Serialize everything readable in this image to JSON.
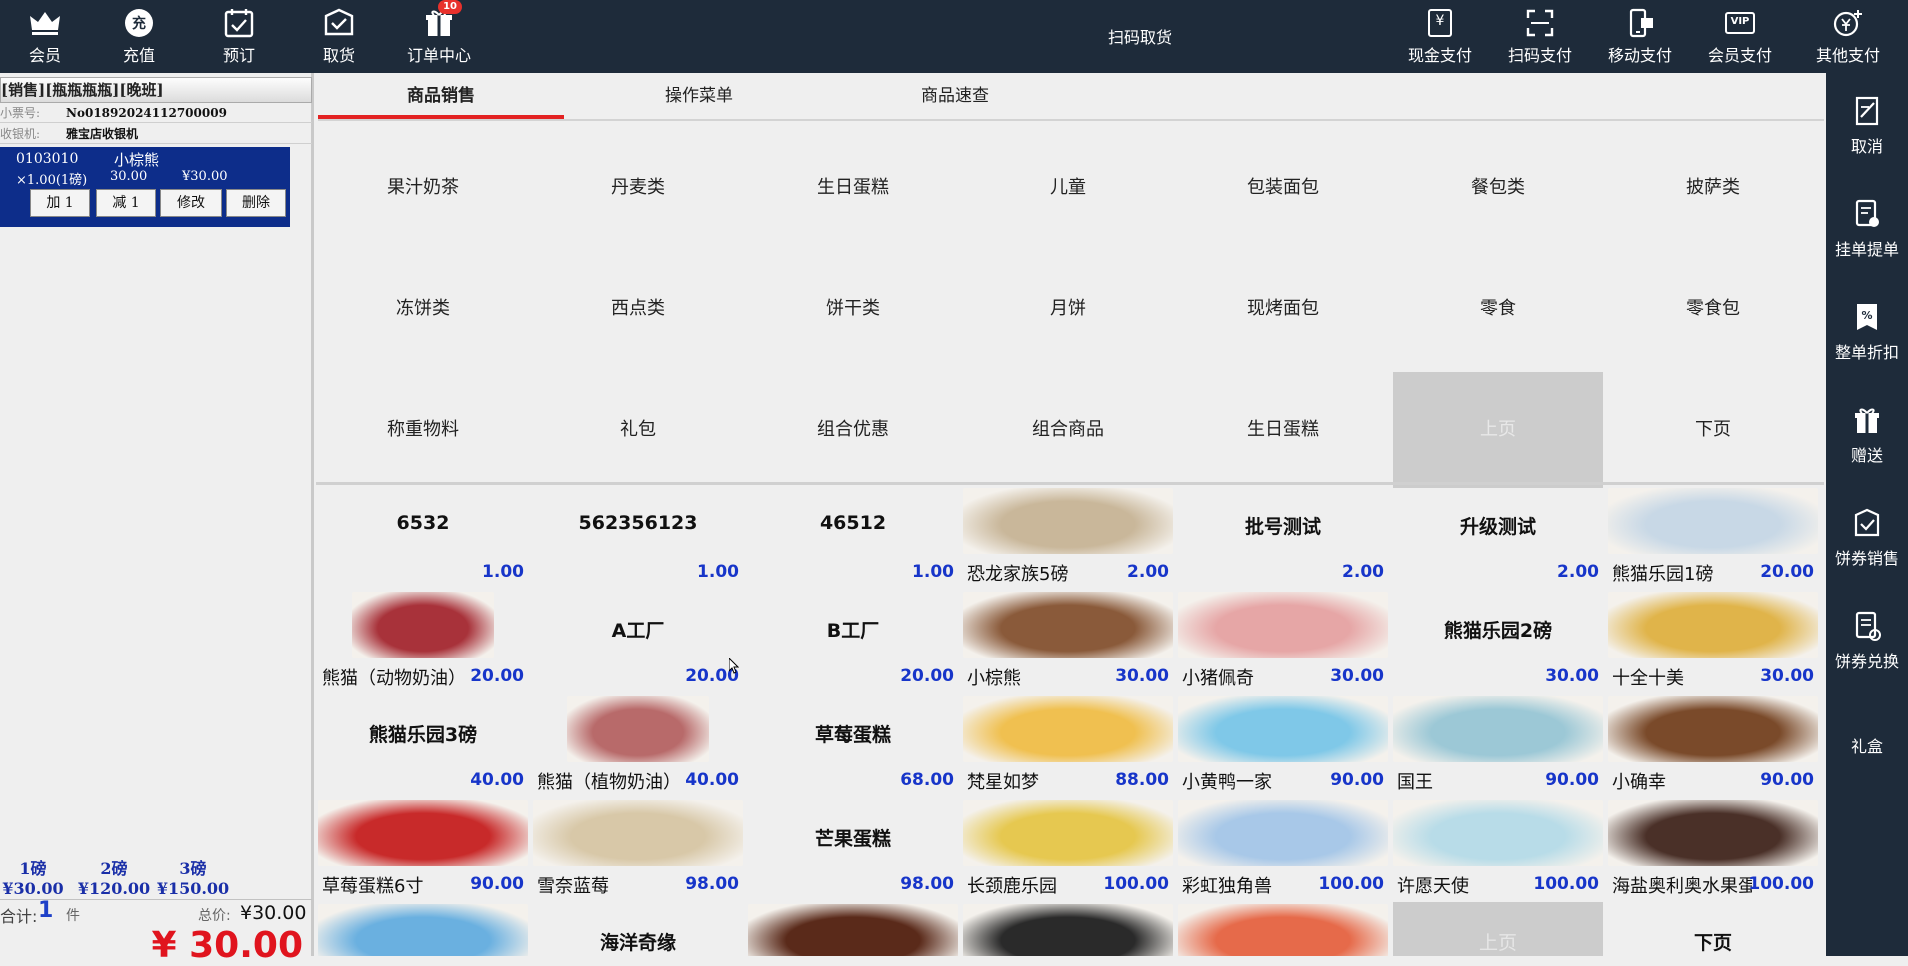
{
  "topbar": {
    "left_buttons": [
      {
        "label": "会员",
        "icon": "crown-icon"
      },
      {
        "label": "充值",
        "icon": "recharge-icon",
        "glyph": "充"
      },
      {
        "label": "预订",
        "icon": "calendar-check-icon"
      },
      {
        "label": "取货",
        "icon": "pickup-box-icon"
      },
      {
        "label": "订单中心",
        "icon": "gift-icon",
        "badge": "10"
      }
    ],
    "center_title": "扫码取货",
    "right_buttons": [
      {
        "label": "现金支付",
        "icon": "cash-icon",
        "glyph": "¥"
      },
      {
        "label": "扫码支付",
        "icon": "scan-icon"
      },
      {
        "label": "移动支付",
        "icon": "mobile-pay-icon"
      },
      {
        "label": "会员支付",
        "icon": "vip-card-icon",
        "glyph": "VIP"
      },
      {
        "label": "其他支付",
        "icon": "coin-plus-icon"
      }
    ]
  },
  "left_panel": {
    "title": "[销售][瓶瓶瓶瓶][晚班]",
    "ticket_label": "小票号:",
    "ticket_value": "No01892024112700009",
    "cashier_label": "收银机:",
    "cashier_value": "雅宝店收银机",
    "cart_item": {
      "code": "0103010",
      "name": "小棕熊",
      "qty": "×1.00(1磅)",
      "price": "30.00",
      "subtotal": "¥30.00",
      "buttons": [
        "加 1",
        "减 1",
        "修改",
        "删除"
      ]
    },
    "weights": [
      {
        "label": "1磅",
        "value": "¥30.00"
      },
      {
        "label": "2磅",
        "value": "¥120.00"
      },
      {
        "label": "3磅",
        "value": "¥150.00"
      }
    ],
    "summary": {
      "count_label": "合计:",
      "count_value": "1",
      "count_unit": "件",
      "total_label": "总价:",
      "total_value": "¥30.00"
    },
    "grand_total": "¥ 30.00"
  },
  "tabs": [
    "商品销售",
    "操作菜单",
    "商品速查"
  ],
  "active_tab": 0,
  "categories": [
    "果汁奶茶",
    "丹麦类",
    "生日蛋糕",
    "儿童",
    "包装面包",
    "餐包类",
    "披萨类",
    "冻饼类",
    "西点类",
    "饼干类",
    "月饼",
    "现烤面包",
    "零食",
    "零食包",
    "称重物料",
    "礼包",
    "组合优惠",
    "组合商品",
    "生日蛋糕",
    "上页",
    "下页"
  ],
  "disabled_category_index": 19,
  "products": [
    {
      "title": "6532",
      "name": "",
      "price": "1.00",
      "img": ""
    },
    {
      "title": "562356123",
      "name": "",
      "price": "1.00",
      "img": ""
    },
    {
      "title": "46512",
      "name": "",
      "price": "1.00",
      "img": ""
    },
    {
      "title": "",
      "name": "恐龙家族5磅",
      "price": "2.00",
      "img": "#c9b79a"
    },
    {
      "title": "批号测试",
      "name": "",
      "price": "2.00",
      "img": ""
    },
    {
      "title": "升级测试",
      "name": "",
      "price": "2.00",
      "img": ""
    },
    {
      "title": "",
      "name": "熊猫乐园1磅",
      "price": "20.00",
      "img": "#c8d8e6"
    },
    {
      "title": "",
      "name": "熊猫（动物奶油）",
      "price": "20.00",
      "img": "#a8323a",
      "small": true
    },
    {
      "title": "A工厂",
      "name": "",
      "price": "20.00",
      "img": ""
    },
    {
      "title": "B工厂",
      "name": "",
      "price": "20.00",
      "img": ""
    },
    {
      "title": "",
      "name": "小棕熊",
      "price": "30.00",
      "img": "#8a5a3a"
    },
    {
      "title": "",
      "name": "小猪佩奇",
      "price": "30.00",
      "img": "#e6a6a6"
    },
    {
      "title": "熊猫乐园2磅",
      "name": "",
      "price": "30.00",
      "img": ""
    },
    {
      "title": "",
      "name": "十全十美",
      "price": "30.00",
      "img": "#e0b44a"
    },
    {
      "title": "熊猫乐园3磅",
      "name": "",
      "price": "40.00",
      "img": ""
    },
    {
      "title": "",
      "name": "熊猫（植物奶油）",
      "price": "40.00",
      "img": "#b86a6a",
      "small": true
    },
    {
      "title": "草莓蛋糕",
      "name": "",
      "price": "68.00",
      "img": ""
    },
    {
      "title": "",
      "name": "梵星如梦",
      "price": "88.00",
      "img": "#f0c050"
    },
    {
      "title": "",
      "name": "小黄鸭一家",
      "price": "90.00",
      "img": "#7fc8e8"
    },
    {
      "title": "",
      "name": "国王",
      "price": "90.00",
      "img": "#9cc8d6"
    },
    {
      "title": "",
      "name": "小确幸",
      "price": "90.00",
      "img": "#7a4a2a"
    },
    {
      "title": "",
      "name": "草莓蛋糕6寸",
      "price": "90.00",
      "img": "#c82a2a"
    },
    {
      "title": "",
      "name": "雪奈蓝莓",
      "price": "98.00",
      "img": "#d8c8a8"
    },
    {
      "title": "芒果蛋糕",
      "name": "",
      "price": "98.00",
      "img": ""
    },
    {
      "title": "",
      "name": "长颈鹿乐园",
      "price": "100.00",
      "img": "#e6c850"
    },
    {
      "title": "",
      "name": "彩虹独角兽",
      "price": "100.00",
      "img": "#a8c8e8"
    },
    {
      "title": "",
      "name": "许愿天使",
      "price": "100.00",
      "img": "#b8dce8"
    },
    {
      "title": "",
      "name": "海盐奥利奥水果蛋",
      "price": "100.00",
      "img": "#4a3028"
    },
    {
      "title": "",
      "name": "",
      "price": "",
      "img": "#6ab0e0"
    },
    {
      "title": "海洋奇缘",
      "name": "",
      "price": "",
      "img": ""
    },
    {
      "title": "",
      "name": "",
      "price": "",
      "img": "#5a2a1a"
    },
    {
      "title": "",
      "name": "",
      "price": "",
      "img": "#2a2a2a"
    },
    {
      "title": "",
      "name": "",
      "price": "",
      "img": "#e66a4a"
    },
    {
      "title": "上页",
      "name": "",
      "price": "",
      "img": "",
      "disabled": true
    },
    {
      "title": "下页",
      "name": "",
      "price": "",
      "img": ""
    }
  ],
  "right_buttons": [
    {
      "label": "取消",
      "icon": "cancel-doc-icon"
    },
    {
      "label": "挂单提单",
      "icon": "hold-order-icon"
    },
    {
      "label": "整单折扣",
      "icon": "discount-icon"
    },
    {
      "label": "赠送",
      "icon": "gift-icon"
    },
    {
      "label": "饼券销售",
      "icon": "coupon-sale-icon"
    },
    {
      "label": "饼券兑换",
      "icon": "coupon-redeem-icon"
    },
    {
      "label": "礼盒",
      "icon": "gift-box-icon"
    }
  ]
}
